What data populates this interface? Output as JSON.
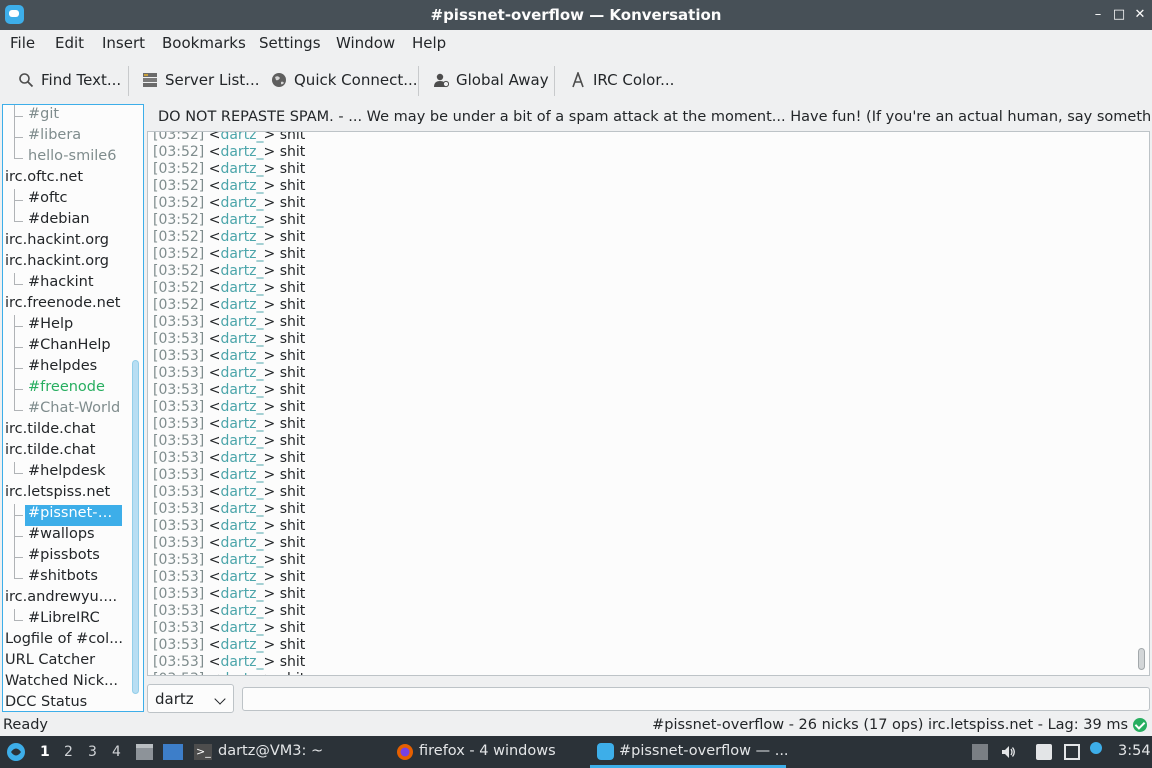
{
  "window": {
    "title": "#pissnet-overflow — Konversation"
  },
  "menu": [
    "File",
    "Edit",
    "Insert",
    "Bookmarks",
    "Settings",
    "Window",
    "Help"
  ],
  "toolbar": {
    "find": "Find Text...",
    "server_list": "Server List...",
    "quick_connect": "Quick Connect...",
    "global_away": "Global Away",
    "irc_color": "IRC Color..."
  },
  "sidebar": {
    "items": [
      {
        "label": "#git",
        "kind": "chan",
        "state": "dim"
      },
      {
        "label": "#libera",
        "kind": "chan",
        "state": "dim"
      },
      {
        "label": "hello-smile6",
        "kind": "chan",
        "state": "dim"
      },
      {
        "label": "irc.oftc.net",
        "kind": "server",
        "state": "normal"
      },
      {
        "label": "#oftc",
        "kind": "chan",
        "state": "normal"
      },
      {
        "label": "#debian",
        "kind": "chan",
        "state": "normal"
      },
      {
        "label": "irc.hackint.org",
        "kind": "server",
        "state": "normal"
      },
      {
        "label": "irc.hackint.org",
        "kind": "server",
        "state": "normal"
      },
      {
        "label": "#hackint",
        "kind": "chan",
        "state": "normal"
      },
      {
        "label": "irc.freenode.net",
        "kind": "server",
        "state": "normal"
      },
      {
        "label": "#Help",
        "kind": "chan",
        "state": "normal"
      },
      {
        "label": "#ChanHelp",
        "kind": "chan",
        "state": "normal"
      },
      {
        "label": "#helpdes",
        "kind": "chan",
        "state": "normal"
      },
      {
        "label": "#freenode",
        "kind": "chan",
        "state": "green"
      },
      {
        "label": "#Chat-World",
        "kind": "chan",
        "state": "dim"
      },
      {
        "label": "irc.tilde.chat",
        "kind": "server",
        "state": "normal"
      },
      {
        "label": "irc.tilde.chat",
        "kind": "server",
        "state": "normal"
      },
      {
        "label": "#helpdesk",
        "kind": "chan",
        "state": "normal"
      },
      {
        "label": "irc.letspiss.net",
        "kind": "server",
        "state": "normal"
      },
      {
        "label": "#pissnet-ov...",
        "kind": "chan",
        "state": "selected"
      },
      {
        "label": "#wallops",
        "kind": "chan",
        "state": "normal"
      },
      {
        "label": "#pissbots",
        "kind": "chan",
        "state": "normal"
      },
      {
        "label": "#shitbots",
        "kind": "chan",
        "state": "normal"
      },
      {
        "label": "irc.andrewyu....",
        "kind": "server",
        "state": "normal"
      },
      {
        "label": "#LibreIRC",
        "kind": "chan",
        "state": "normal"
      },
      {
        "label": "Logfile of #col...",
        "kind": "server",
        "state": "normal"
      },
      {
        "label": "URL Catcher",
        "kind": "server",
        "state": "normal"
      },
      {
        "label": "Watched Nick...",
        "kind": "server",
        "state": "normal"
      },
      {
        "label": "DCC Status",
        "kind": "server",
        "state": "normal"
      }
    ]
  },
  "topic": {
    "text": "DO NOT REPASTE SPAM. - ... We may be under a bit of a spam attack at the moment... Have fun! (If you're an actual human, say something to ..."
  },
  "chat": {
    "lines": [
      {
        "time": "[03:52]",
        "nick": "dartz_",
        "msg": "shit"
      },
      {
        "time": "[03:52]",
        "nick": "dartz_",
        "msg": "shit"
      },
      {
        "time": "[03:52]",
        "nick": "dartz_",
        "msg": "shit"
      },
      {
        "time": "[03:52]",
        "nick": "dartz_",
        "msg": "shit"
      },
      {
        "time": "[03:52]",
        "nick": "dartz_",
        "msg": "shit"
      },
      {
        "time": "[03:52]",
        "nick": "dartz_",
        "msg": "shit"
      },
      {
        "time": "[03:52]",
        "nick": "dartz_",
        "msg": "shit"
      },
      {
        "time": "[03:52]",
        "nick": "dartz_",
        "msg": "shit"
      },
      {
        "time": "[03:52]",
        "nick": "dartz_",
        "msg": "shit"
      },
      {
        "time": "[03:52]",
        "nick": "dartz_",
        "msg": "shit"
      },
      {
        "time": "[03:52]",
        "nick": "dartz_",
        "msg": "shit"
      },
      {
        "time": "[03:53]",
        "nick": "dartz_",
        "msg": "shit"
      },
      {
        "time": "[03:53]",
        "nick": "dartz_",
        "msg": "shit"
      },
      {
        "time": "[03:53]",
        "nick": "dartz_",
        "msg": "shit"
      },
      {
        "time": "[03:53]",
        "nick": "dartz_",
        "msg": "shit"
      },
      {
        "time": "[03:53]",
        "nick": "dartz_",
        "msg": "shit"
      },
      {
        "time": "[03:53]",
        "nick": "dartz_",
        "msg": "shit"
      },
      {
        "time": "[03:53]",
        "nick": "dartz_",
        "msg": "shit"
      },
      {
        "time": "[03:53]",
        "nick": "dartz_",
        "msg": "shit"
      },
      {
        "time": "[03:53]",
        "nick": "dartz_",
        "msg": "shit"
      },
      {
        "time": "[03:53]",
        "nick": "dartz_",
        "msg": "shit"
      },
      {
        "time": "[03:53]",
        "nick": "dartz_",
        "msg": "shit"
      },
      {
        "time": "[03:53]",
        "nick": "dartz_",
        "msg": "shit"
      },
      {
        "time": "[03:53]",
        "nick": "dartz_",
        "msg": "shit"
      },
      {
        "time": "[03:53]",
        "nick": "dartz_",
        "msg": "shit"
      },
      {
        "time": "[03:53]",
        "nick": "dartz_",
        "msg": "shit"
      },
      {
        "time": "[03:53]",
        "nick": "dartz_",
        "msg": "shit"
      },
      {
        "time": "[03:53]",
        "nick": "dartz_",
        "msg": "shit"
      },
      {
        "time": "[03:53]",
        "nick": "dartz_",
        "msg": "shit"
      },
      {
        "time": "[03:53]",
        "nick": "dartz_",
        "msg": "shit"
      },
      {
        "time": "[03:53]",
        "nick": "dartz_",
        "msg": "shit"
      },
      {
        "time": "[03:53]",
        "nick": "dartz_",
        "msg": "shit"
      },
      {
        "time": "[03:53]",
        "nick": "dartz_",
        "msg": "shit"
      }
    ]
  },
  "input": {
    "nick": "dartz",
    "message": ""
  },
  "status": {
    "left": "Ready",
    "right": "#pissnet-overflow - 26 nicks (17 ops)  irc.letspiss.net - Lag: 39 ms"
  },
  "taskbar": {
    "workspaces": [
      "1",
      "2",
      "3",
      "4"
    ],
    "tasks": [
      "dartz@VM3: ~",
      "firefox - 4 windows",
      "#pissnet-overflow — ..."
    ],
    "clock": "3:54"
  },
  "colors": {
    "accent": "#3daee9",
    "nick": "#4ba5aa",
    "green": "#27ae60"
  }
}
